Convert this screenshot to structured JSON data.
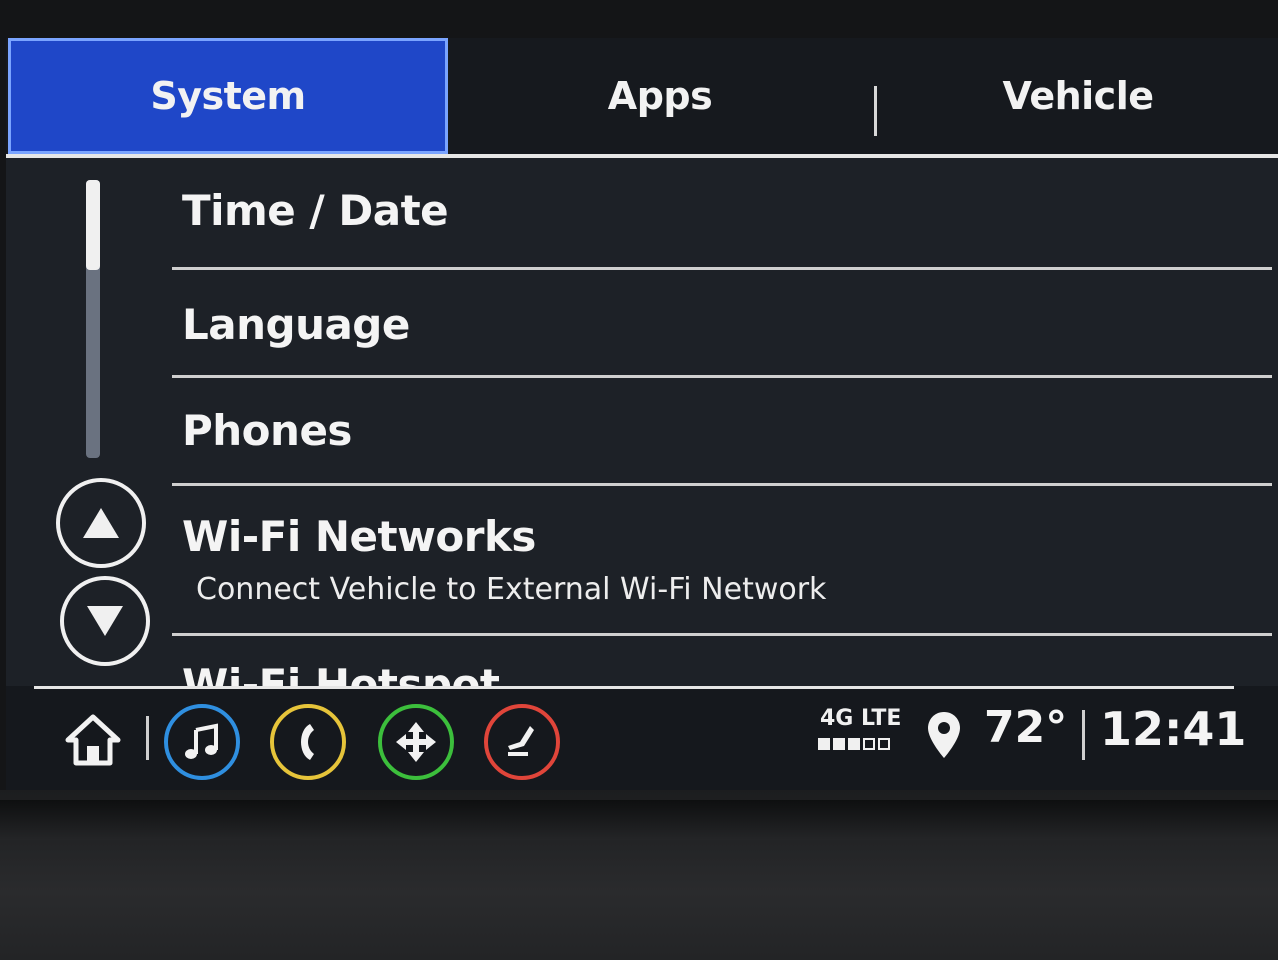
{
  "tabs": [
    {
      "label": "System",
      "active": true
    },
    {
      "label": "Apps",
      "active": false
    },
    {
      "label": "Vehicle",
      "active": false
    }
  ],
  "menu": {
    "items": [
      {
        "title": "Time / Date"
      },
      {
        "title": "Language"
      },
      {
        "title": "Phones"
      },
      {
        "title": "Wi-Fi Networks",
        "subtitle": "Connect Vehicle to External Wi-Fi Network"
      },
      {
        "title": "Wi-Fi Hotspot"
      }
    ]
  },
  "scroll": {
    "up_icon": "triangle-up-icon",
    "down_icon": "triangle-down-icon"
  },
  "bottom_bar": {
    "apps": [
      {
        "icon": "home-icon"
      },
      {
        "icon": "music-note-icon",
        "color": "#2f8fe0"
      },
      {
        "icon": "phone-icon",
        "color": "#e6c43a"
      },
      {
        "icon": "navigation-icon",
        "color": "#3cbf3c"
      },
      {
        "icon": "seat-icon",
        "color": "#e0453a"
      }
    ],
    "network": "4G LTE",
    "signal_bars": 3,
    "signal_bars_total": 5,
    "temperature": "72°",
    "time": "12:41"
  },
  "colors": {
    "active_tab": "#1f47c8",
    "screen_bg": "#1d2127"
  }
}
